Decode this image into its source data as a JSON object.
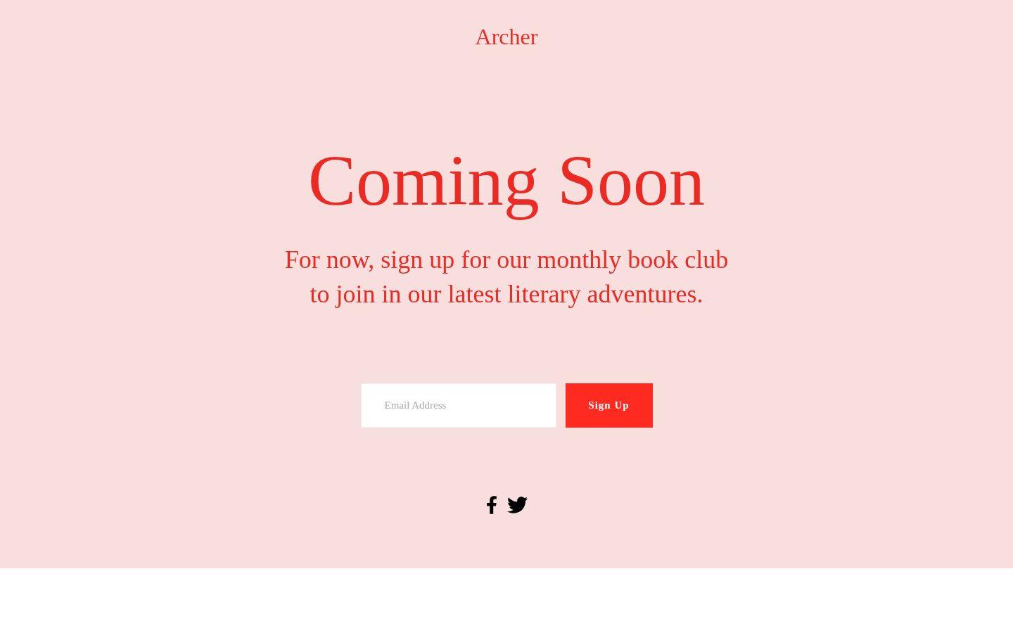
{
  "brand": "Archer",
  "heading": "Coming Soon",
  "subtitle": "For now, sign up for our monthly book club to join in our latest literary adventures.",
  "signup_form": {
    "email_field": {
      "placeholder": "Email Address"
    },
    "submit_button": "Sign Up"
  },
  "social_links": [
    {
      "kind": "facebook"
    },
    {
      "kind": "twitter"
    }
  ]
}
